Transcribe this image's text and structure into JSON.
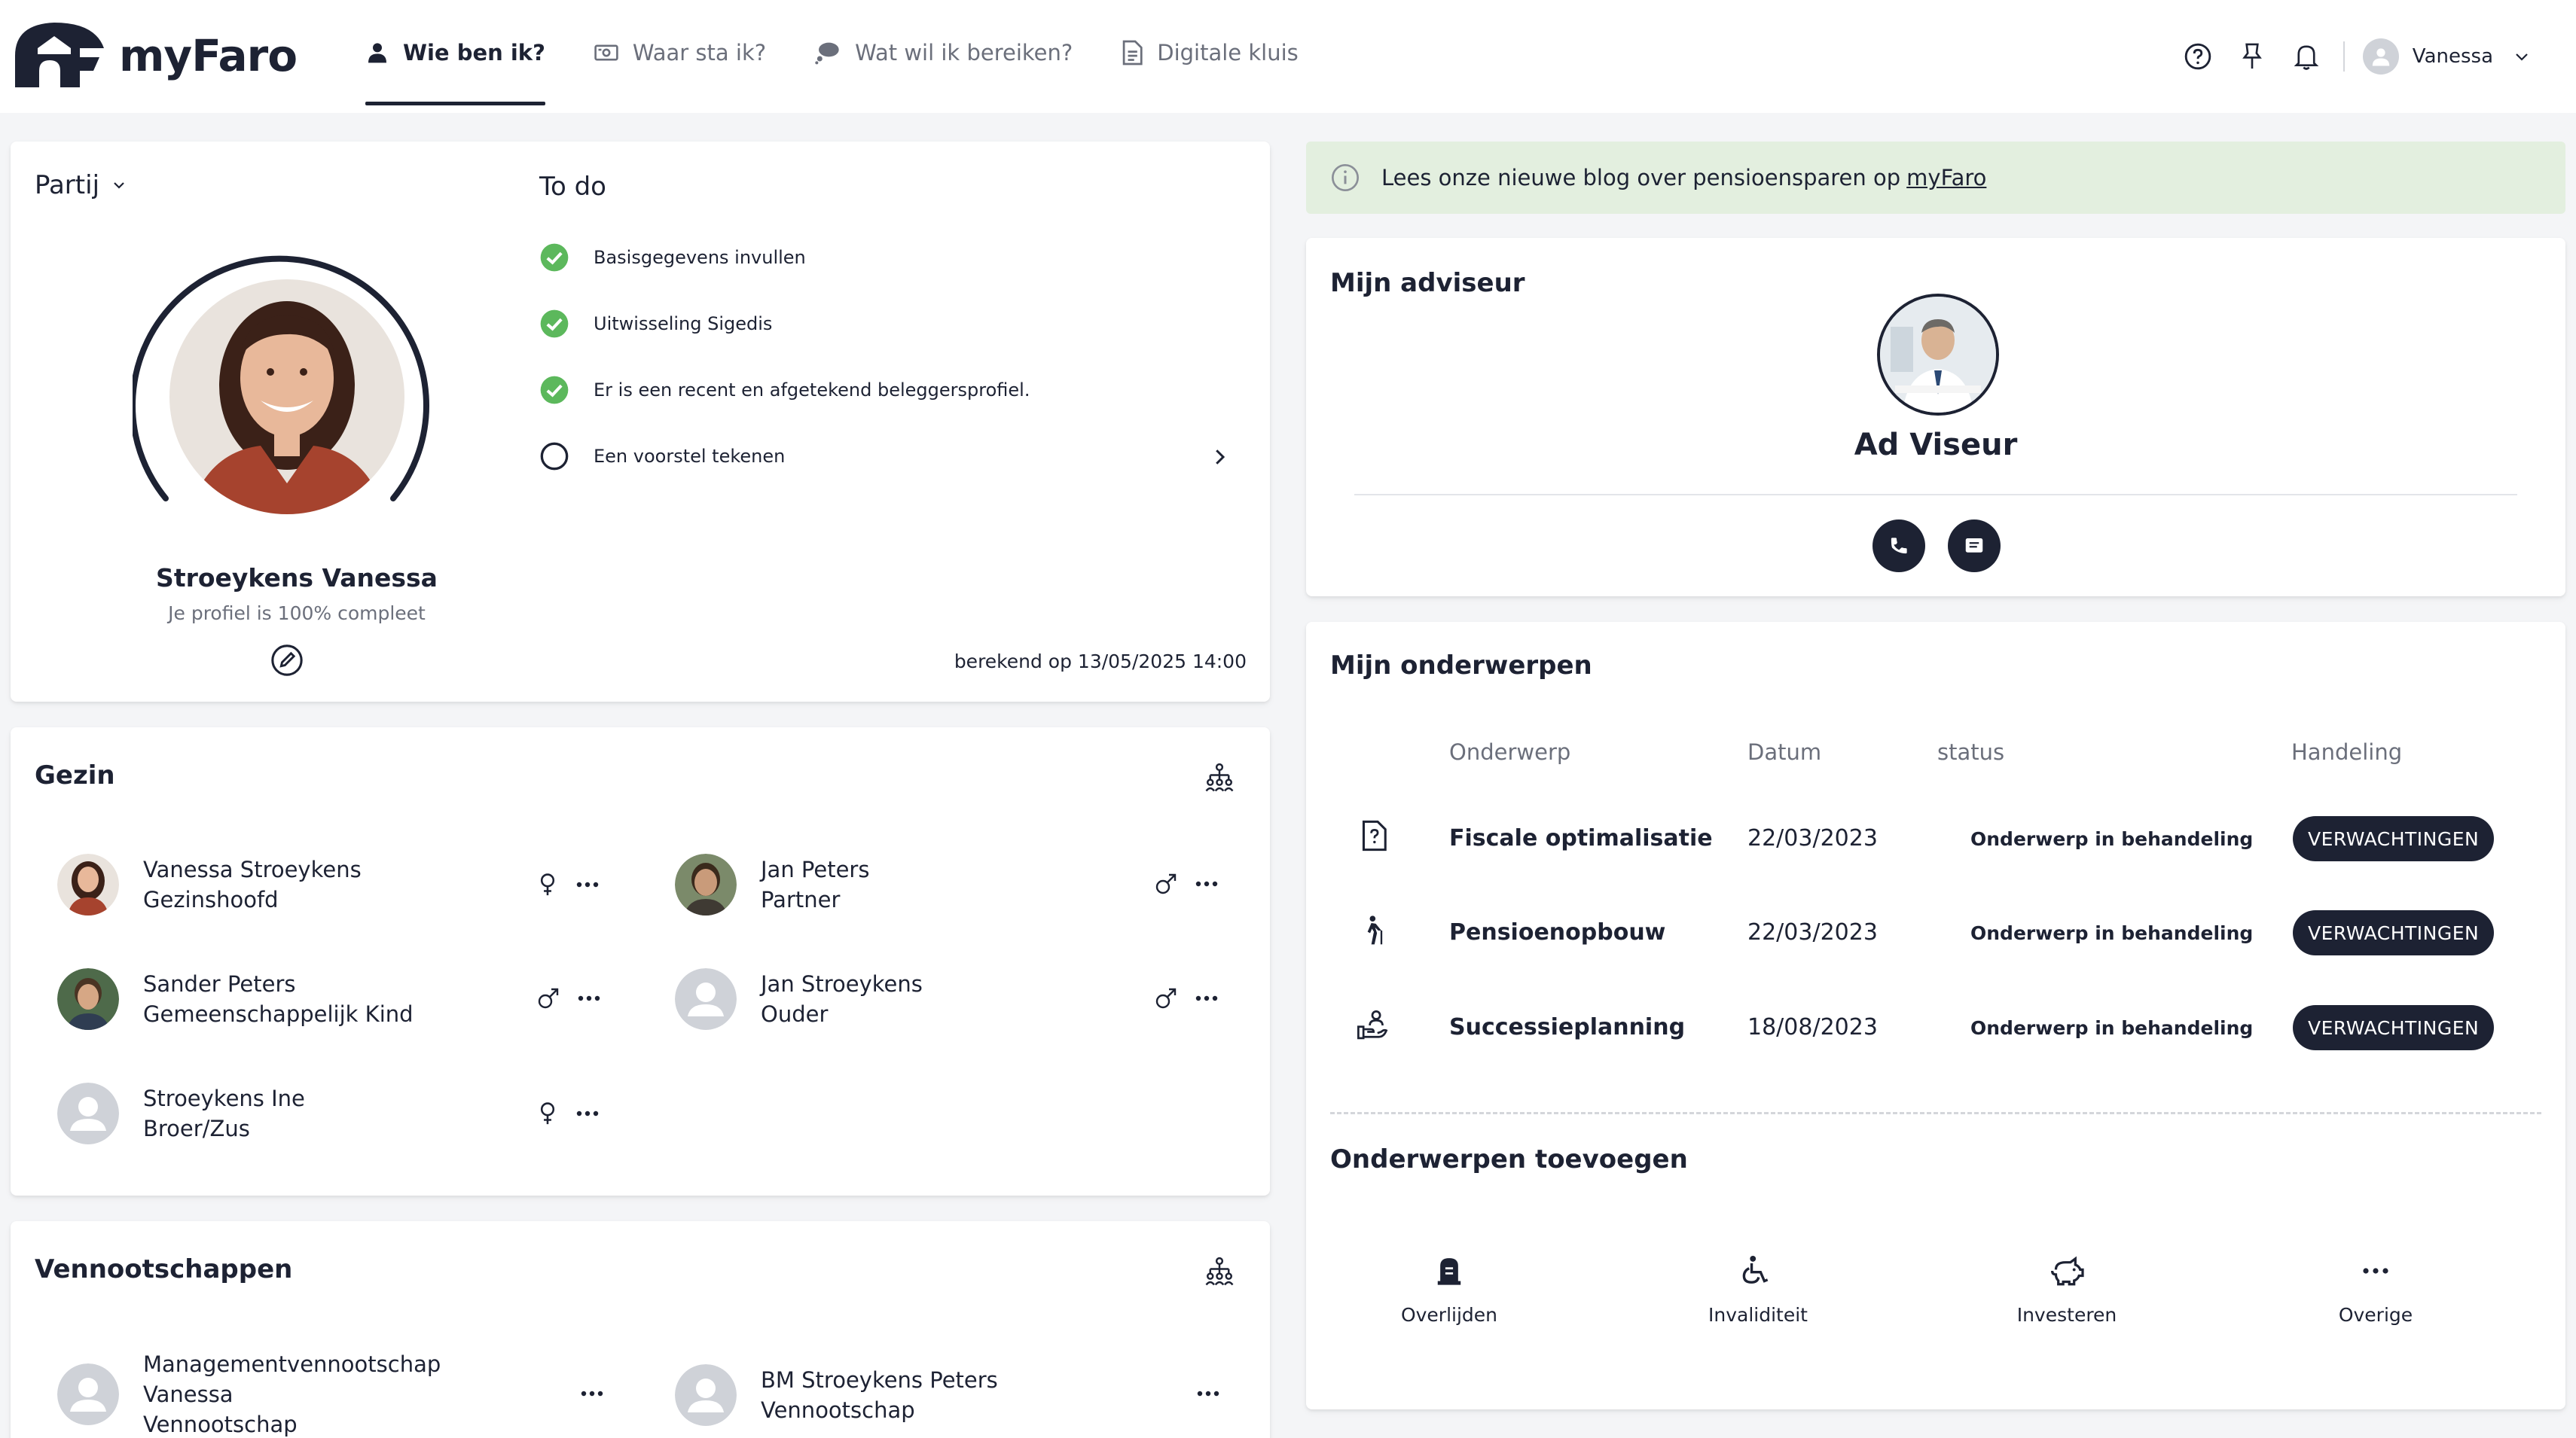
{
  "app": {
    "logo_text": "myFaro"
  },
  "nav": {
    "items": [
      {
        "label": "Wie ben ik?",
        "active": true
      },
      {
        "label": "Waar sta ik?",
        "active": false
      },
      {
        "label": "Wat wil ik bereiken?",
        "active": false
      },
      {
        "label": "Digitale kluis",
        "active": false
      }
    ]
  },
  "header": {
    "user_name": "Vanessa"
  },
  "partij": {
    "title": "Partij",
    "name": "Stroeykens Vanessa",
    "completeness": "Je profiel is 100% compleet"
  },
  "todo": {
    "title": "To do",
    "items": [
      {
        "label": "Basisgegevens invullen",
        "done": true
      },
      {
        "label": "Uitwisseling Sigedis",
        "done": true
      },
      {
        "label": "Er is een recent en afgetekend beleggersprofiel.",
        "done": true
      },
      {
        "label": "Een voorstel tekenen",
        "done": false
      }
    ],
    "computed": "berekend op 13/05/2025 14:00"
  },
  "gezin": {
    "title": "Gezin",
    "members": [
      {
        "name": "Vanessa Stroeykens",
        "role": "Gezinshoofd",
        "gender": "female"
      },
      {
        "name": "Jan Peters",
        "role": "Partner",
        "gender": "male"
      },
      {
        "name": "Sander Peters",
        "role": "Gemeenschappelijk Kind",
        "gender": "male"
      },
      {
        "name": "Jan Stroeykens",
        "role": "Ouder",
        "gender": "male"
      },
      {
        "name": "Stroeykens Ine",
        "role": "Broer/Zus",
        "gender": "female"
      }
    ]
  },
  "vennootschappen": {
    "title": "Vennootschappen",
    "items": [
      {
        "name_line1": "Managementvennootschap",
        "name_line2": "Vanessa",
        "type": "Vennootschap"
      },
      {
        "name_line1": "BM Stroeykens Peters",
        "type": "Vennootschap"
      }
    ]
  },
  "banner": {
    "text": "Lees onze nieuwe blog over pensioensparen op ",
    "link": "myFaro"
  },
  "adviser": {
    "title": "Mijn adviseur",
    "name": "Ad Viseur"
  },
  "topics": {
    "title": "Mijn onderwerpen",
    "headers": {
      "subject": "Onderwerp",
      "date": "Datum",
      "status": "status",
      "action": "Handeling"
    },
    "rows": [
      {
        "icon": "document-question-icon",
        "subject": "Fiscale optimalisatie",
        "date": "22/03/2023",
        "status": "Onderwerp in behandeling",
        "action": "VERWACHTINGEN"
      },
      {
        "icon": "walking-person-icon",
        "subject": "Pensioenopbouw",
        "date": "22/03/2023",
        "status": "Onderwerp in behandeling",
        "action": "VERWACHTINGEN"
      },
      {
        "icon": "hand-person-icon",
        "subject": "Successieplanning",
        "date": "18/08/2023",
        "status": "Onderwerp in behandeling",
        "action": "VERWACHTINGEN"
      }
    ]
  },
  "add_topics": {
    "title": "Onderwerpen toevoegen",
    "items": [
      {
        "icon": "tombstone-icon",
        "label": "Overlijden"
      },
      {
        "icon": "wheelchair-icon",
        "label": "Invaliditeit"
      },
      {
        "icon": "piggy-bank-icon",
        "label": "Investeren"
      },
      {
        "icon": "more-icon",
        "label": "Overige"
      }
    ]
  },
  "colors": {
    "primary": "#1d2233",
    "success": "#5cb85c",
    "banner_bg": "#e3efdf"
  }
}
